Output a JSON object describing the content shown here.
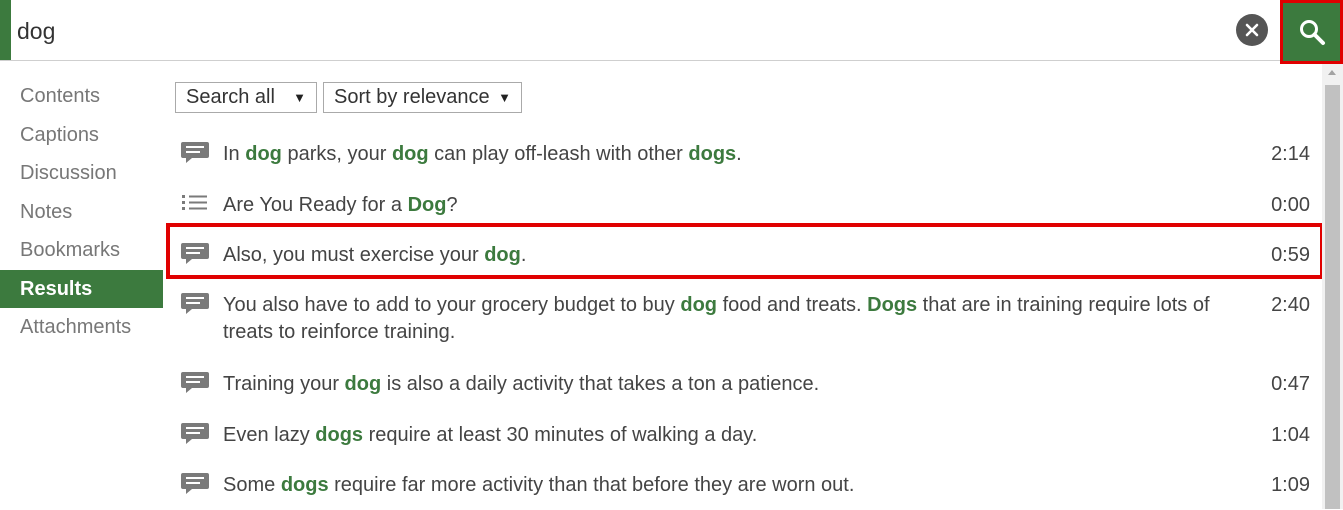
{
  "search": {
    "value": "dog",
    "placeholder": ""
  },
  "icons": {
    "clear": "close-icon",
    "search": "search-icon",
    "caption": "speech-bubble-icon",
    "chapter": "list-icon"
  },
  "colors": {
    "accent": "#3c7a3e",
    "highlight_border": "#e00000"
  },
  "sidebar": {
    "items": [
      {
        "label": "Contents"
      },
      {
        "label": "Captions"
      },
      {
        "label": "Discussion"
      },
      {
        "label": "Notes"
      },
      {
        "label": "Bookmarks"
      },
      {
        "label": "Results"
      },
      {
        "label": "Attachments"
      }
    ],
    "active": "Results"
  },
  "filters": {
    "scope": "Search all",
    "sort": "Sort by relevance"
  },
  "results": [
    {
      "type": "caption",
      "segments": [
        "In ",
        "dog",
        " parks, your ",
        "dog",
        " can play off-leash with other ",
        "dogs",
        "."
      ],
      "time": "2:14"
    },
    {
      "type": "chapter",
      "segments": [
        "Are You Ready for a ",
        "Dog",
        "?"
      ],
      "time": "0:00"
    },
    {
      "type": "caption",
      "segments": [
        "Also, you must exercise your ",
        "dog",
        "."
      ],
      "time": "0:59",
      "selected": true
    },
    {
      "type": "caption",
      "segments": [
        "You also have to add to your grocery budget to buy ",
        "dog",
        " food and treats. ",
        "Dogs",
        " that are in training require lots of treats to reinforce training."
      ],
      "time": "2:40"
    },
    {
      "type": "caption",
      "segments": [
        "Training your ",
        "dog",
        " is also a daily activity that takes a ton a patience."
      ],
      "time": "0:47"
    },
    {
      "type": "caption",
      "segments": [
        "Even lazy ",
        "dogs",
        " require at least 30 minutes of walking a day."
      ],
      "time": "1:04"
    },
    {
      "type": "caption",
      "segments": [
        "Some ",
        "dogs",
        " require far more activity than that before they are worn out."
      ],
      "time": "1:09"
    }
  ]
}
